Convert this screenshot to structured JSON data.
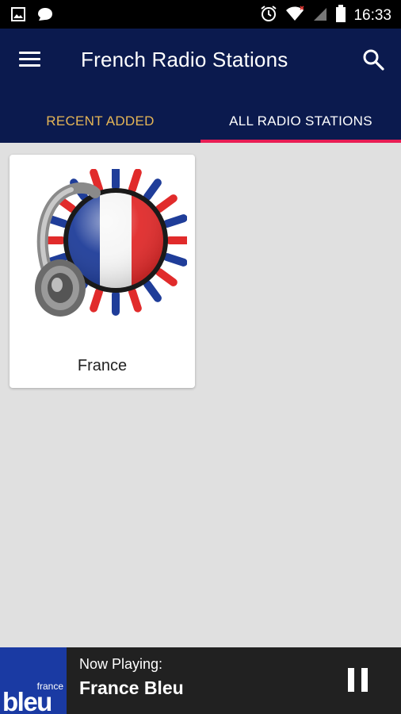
{
  "status_bar": {
    "time": "16:33",
    "left_icons": [
      "image-icon",
      "chat-bubble-icon"
    ],
    "right_icons": [
      "alarm-icon",
      "wifi-icon",
      "signal-icon",
      "battery-icon"
    ]
  },
  "app_bar": {
    "title": "French Radio Stations",
    "menu_icon": "menu-icon",
    "search_icon": "search-icon",
    "background_color": "#0b1a4e"
  },
  "tabs": [
    {
      "label": "RECENT ADDED",
      "selected": false,
      "color": "#e6b656"
    },
    {
      "label": "ALL RADIO STATIONS",
      "selected": true,
      "color": "#ffffff"
    }
  ],
  "tab_indicator_color": "#e91e55",
  "stations": [
    {
      "label": "France",
      "icon": "france-flag-headphones-icon"
    }
  ],
  "player": {
    "logo_text_small": "france",
    "logo_text_large": "bleu",
    "now_playing_label": "Now Playing:",
    "station_name": "France Bleu",
    "control_icon": "pause-icon",
    "background_color": "#212121",
    "logo_color": "#1a3aa3"
  }
}
